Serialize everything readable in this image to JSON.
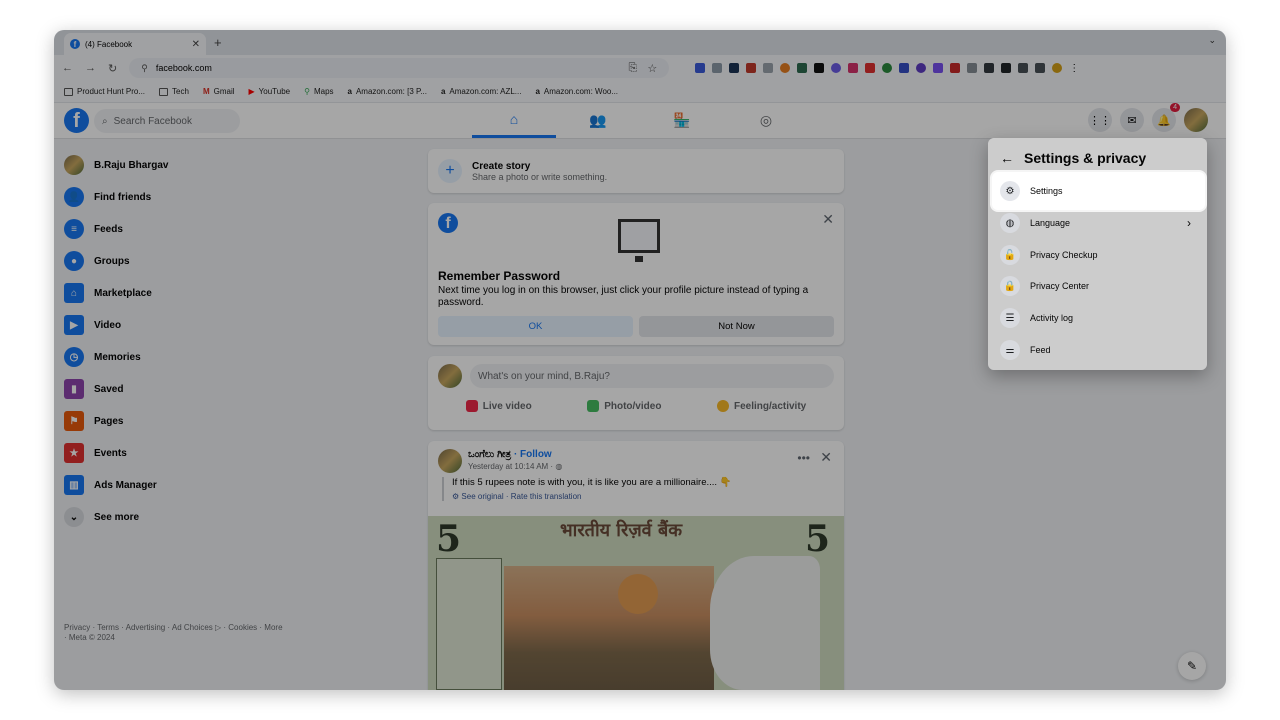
{
  "browser": {
    "tab_title": "(4) Facebook",
    "url": "facebook.com",
    "bookmarks": [
      "Product Hunt Pro...",
      "Tech",
      "Gmail",
      "YouTube",
      "Maps",
      "Amazon.com: [3 P...",
      "Amazon.com: AZL...",
      "Amazon.com: Woo..."
    ]
  },
  "fb": {
    "search_placeholder": "Search Facebook",
    "notification_count": "4",
    "left_nav": [
      "B.Raju Bhargav",
      "Find friends",
      "Feeds",
      "Groups",
      "Marketplace",
      "Video",
      "Memories",
      "Saved",
      "Pages",
      "Events",
      "Ads Manager",
      "See more"
    ],
    "legal": "Privacy · Terms · Advertising · Ad Choices ▷ · Cookies · More · Meta © 2024",
    "story": {
      "title": "Create story",
      "subtitle": "Share a photo or write something."
    },
    "remember": {
      "title": "Remember Password",
      "body": "Next time you log in on this browser, just click your profile picture instead of typing a password.",
      "ok": "OK",
      "not_now": "Not Now"
    },
    "composer": {
      "placeholder": "What's on your mind, B.Raju?",
      "actions": [
        "Live video",
        "Photo/video",
        "Feeling/activity"
      ]
    },
    "post": {
      "author": "ಒಂಗೆಲು ಗೀತ್ರ",
      "follow": "· Follow",
      "time": "Yesterday at 10:14 AM ·",
      "text": "If this 5 rupees note is with you, it is like you are a millionaire.... 👇",
      "translation": "See original · Rate this translation",
      "note_header": "भारतीय रिज़र्व बैंक",
      "note_numeral": "5"
    }
  },
  "settings_menu": {
    "title": "Settings & privacy",
    "items": [
      "Settings",
      "Language",
      "Privacy Checkup",
      "Privacy Center",
      "Activity log",
      "Feed"
    ]
  }
}
